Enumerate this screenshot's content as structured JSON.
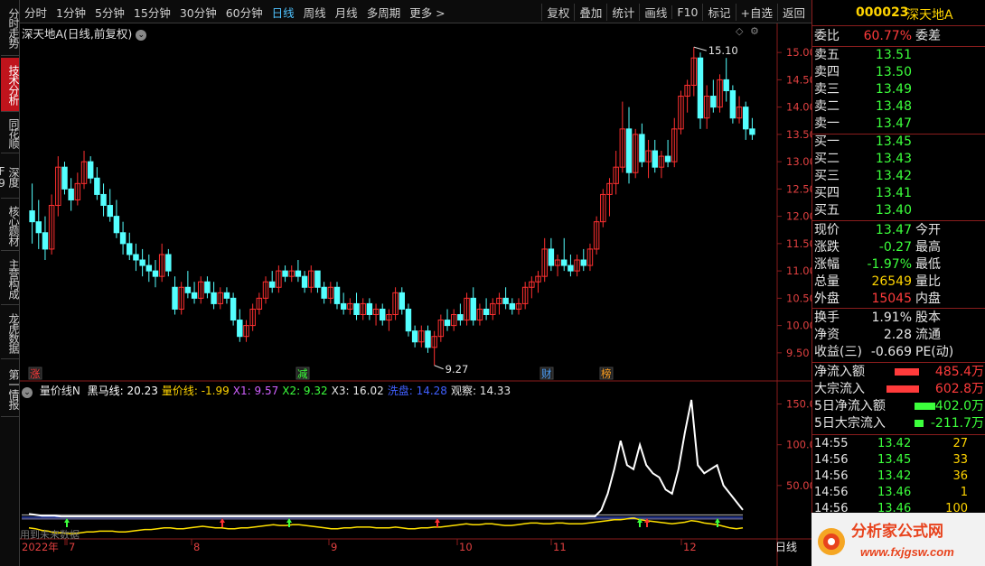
{
  "toolbar": {
    "periods": [
      "分时",
      "1分钟",
      "5分钟",
      "15分钟",
      "30分钟",
      "60分钟",
      "日线",
      "周线",
      "月线",
      "多周期",
      "更多 >"
    ],
    "active_period": "日线",
    "tools": [
      "复权",
      "叠加",
      "统计",
      "画线",
      "F10",
      "标记",
      "+自选",
      "返回"
    ]
  },
  "left_tabs": [
    {
      "label": "分时走势",
      "active": false
    },
    {
      "label": "技术分析",
      "active": true
    },
    {
      "label": "同花顺",
      "active": false
    },
    {
      "label": "深度F9",
      "active": false
    },
    {
      "label": "核心题材",
      "active": false
    },
    {
      "label": "主营构成",
      "active": false
    },
    {
      "label": "龙虎数据",
      "active": false
    },
    {
      "label": "第一情报",
      "active": false
    }
  ],
  "main_chart": {
    "title": "深天地A(日线,前复权)",
    "high_marker": "15.10",
    "low_marker": "9.27",
    "event_marks": [
      {
        "text": "涨",
        "color": "#ff3b3b"
      },
      {
        "text": "减",
        "color": "#3cff3c"
      },
      {
        "text": "财",
        "color": "#4fa3ff"
      },
      {
        "text": "榜",
        "color": "#ffa020"
      }
    ]
  },
  "indicator": {
    "name": "量价线N",
    "items": [
      {
        "label": "黑马线: 20.23",
        "color": "#ffffff"
      },
      {
        "label": "量价线: -1.99",
        "color": "#ffd400"
      },
      {
        "label": "X1: 9.57",
        "color": "#d060ff"
      },
      {
        "label": "X2: 9.32",
        "color": "#3cff3c"
      },
      {
        "label": "X3: 16.02",
        "color": "#e6e6e6"
      },
      {
        "label": "洗盘: 14.28",
        "color": "#4060ff"
      },
      {
        "label": "观察: 14.33",
        "color": "#e6e6e6"
      }
    ],
    "footer_note": "用到未来数据"
  },
  "x_axis": {
    "labels": [
      "2022年",
      "7",
      "8",
      "9",
      "10",
      "11",
      "12"
    ],
    "period_button": "日线"
  },
  "chart_data": {
    "type": "candlestick",
    "price_axis": {
      "ticks": [
        15.0,
        14.5,
        14.0,
        13.5,
        13.0,
        12.5,
        12.0,
        11.5,
        11.0,
        10.5,
        10.0,
        9.5
      ],
      "ylim": [
        9.2,
        15.3
      ]
    },
    "indicator_axis": {
      "ticks": [
        150.0,
        100.0,
        50.0
      ],
      "ylim": [
        -10,
        165
      ]
    },
    "candles": [
      [
        12.1,
        12.6,
        11.5,
        11.9
      ],
      [
        11.9,
        12.3,
        11.4,
        11.7
      ],
      [
        11.7,
        12.0,
        11.2,
        11.4
      ],
      [
        11.4,
        12.4,
        11.3,
        12.2
      ],
      [
        12.2,
        13.1,
        12.0,
        12.9
      ],
      [
        12.9,
        13.0,
        12.4,
        12.5
      ],
      [
        12.5,
        12.7,
        12.1,
        12.3
      ],
      [
        12.3,
        12.8,
        12.2,
        12.6
      ],
      [
        12.6,
        13.2,
        12.5,
        13.0
      ],
      [
        13.0,
        13.1,
        12.6,
        12.7
      ],
      [
        12.7,
        12.9,
        12.3,
        12.4
      ],
      [
        12.4,
        12.6,
        12.0,
        12.2
      ],
      [
        12.2,
        12.5,
        11.9,
        12.0
      ],
      [
        12.0,
        12.3,
        11.6,
        11.7
      ],
      [
        11.7,
        11.9,
        11.3,
        11.5
      ],
      [
        11.5,
        11.7,
        11.2,
        11.3
      ],
      [
        11.3,
        11.5,
        11.0,
        11.2
      ],
      [
        11.2,
        11.4,
        10.9,
        11.1
      ],
      [
        11.1,
        11.3,
        10.8,
        11.0
      ],
      [
        11.0,
        11.2,
        10.7,
        10.9
      ],
      [
        10.9,
        11.5,
        10.8,
        11.3
      ],
      [
        11.3,
        11.4,
        10.9,
        11.0
      ],
      [
        10.7,
        10.9,
        10.2,
        10.3
      ],
      [
        10.3,
        10.8,
        10.2,
        10.7
      ],
      [
        10.7,
        11.0,
        10.5,
        10.6
      ],
      [
        10.6,
        10.8,
        10.4,
        10.5
      ],
      [
        10.5,
        10.9,
        10.4,
        10.8
      ],
      [
        10.8,
        10.9,
        10.5,
        10.6
      ],
      [
        10.6,
        10.8,
        10.3,
        10.4
      ],
      [
        10.4,
        10.7,
        10.3,
        10.6
      ],
      [
        10.6,
        10.7,
        10.4,
        10.5
      ],
      [
        10.5,
        10.6,
        10.0,
        10.1
      ],
      [
        10.1,
        10.3,
        9.7,
        9.8
      ],
      [
        9.8,
        10.1,
        9.7,
        10.0
      ],
      [
        10.0,
        10.4,
        9.9,
        10.3
      ],
      [
        10.3,
        10.6,
        10.2,
        10.5
      ],
      [
        10.5,
        10.9,
        10.4,
        10.8
      ],
      [
        10.8,
        11.0,
        10.6,
        10.7
      ],
      [
        10.7,
        11.1,
        10.6,
        11.0
      ],
      [
        11.0,
        11.1,
        10.8,
        10.9
      ],
      [
        10.9,
        11.1,
        10.8,
        11.0
      ],
      [
        11.0,
        11.2,
        10.8,
        10.9
      ],
      [
        10.9,
        11.0,
        10.6,
        10.7
      ],
      [
        10.7,
        11.1,
        10.6,
        11.0
      ],
      [
        11.0,
        11.0,
        10.6,
        10.7
      ],
      [
        10.7,
        10.8,
        10.4,
        10.5
      ],
      [
        10.5,
        10.8,
        10.4,
        10.7
      ],
      [
        10.7,
        10.8,
        10.3,
        10.4
      ],
      [
        10.4,
        10.6,
        10.2,
        10.3
      ],
      [
        10.3,
        10.5,
        10.2,
        10.4
      ],
      [
        10.4,
        10.6,
        10.1,
        10.2
      ],
      [
        10.2,
        10.5,
        10.1,
        10.4
      ],
      [
        10.4,
        10.5,
        10.1,
        10.2
      ],
      [
        10.2,
        10.4,
        10.0,
        10.3
      ],
      [
        10.3,
        10.4,
        10.0,
        10.1
      ],
      [
        10.1,
        10.3,
        9.9,
        10.2
      ],
      [
        10.2,
        10.7,
        10.1,
        10.6
      ],
      [
        10.6,
        10.7,
        10.2,
        10.3
      ],
      [
        10.3,
        10.4,
        9.8,
        9.9
      ],
      [
        9.9,
        10.0,
        9.6,
        9.7
      ],
      [
        9.7,
        10.0,
        9.6,
        9.9
      ],
      [
        9.9,
        10.0,
        9.5,
        9.6
      ],
      [
        9.6,
        9.9,
        9.27,
        9.8
      ],
      [
        9.8,
        10.2,
        9.7,
        10.1
      ],
      [
        10.1,
        10.3,
        9.9,
        10.0
      ],
      [
        10.0,
        10.3,
        9.9,
        10.2
      ],
      [
        10.2,
        10.4,
        10.0,
        10.1
      ],
      [
        10.1,
        10.6,
        10.0,
        10.5
      ],
      [
        10.5,
        10.7,
        10.0,
        10.1
      ],
      [
        10.1,
        10.4,
        10.0,
        10.3
      ],
      [
        10.3,
        10.5,
        10.1,
        10.2
      ],
      [
        10.2,
        10.5,
        10.1,
        10.4
      ],
      [
        10.4,
        10.6,
        10.2,
        10.5
      ],
      [
        10.5,
        10.7,
        10.3,
        10.4
      ],
      [
        10.4,
        10.5,
        10.2,
        10.3
      ],
      [
        10.3,
        10.5,
        10.2,
        10.4
      ],
      [
        10.4,
        10.8,
        10.3,
        10.7
      ],
      [
        10.7,
        10.9,
        10.5,
        10.8
      ],
      [
        10.8,
        11.0,
        10.6,
        10.9
      ],
      [
        10.9,
        11.6,
        10.8,
        11.4
      ],
      [
        11.4,
        11.6,
        11.0,
        11.1
      ],
      [
        11.1,
        11.3,
        10.9,
        11.2
      ],
      [
        11.2,
        11.6,
        11.0,
        11.1
      ],
      [
        11.1,
        11.3,
        10.9,
        11.0
      ],
      [
        11.0,
        11.3,
        10.9,
        11.2
      ],
      [
        11.2,
        11.4,
        11.0,
        11.1
      ],
      [
        11.1,
        11.5,
        11.0,
        11.4
      ],
      [
        11.4,
        12.0,
        11.3,
        11.9
      ],
      [
        11.9,
        12.5,
        11.8,
        12.4
      ],
      [
        12.4,
        12.7,
        12.0,
        12.6
      ],
      [
        12.6,
        13.2,
        12.4,
        12.9
      ],
      [
        12.9,
        14.1,
        12.8,
        13.6
      ],
      [
        13.6,
        14.0,
        12.6,
        12.8
      ],
      [
        12.8,
        13.6,
        12.7,
        13.5
      ],
      [
        13.5,
        13.7,
        12.9,
        13.0
      ],
      [
        13.0,
        13.4,
        12.7,
        13.2
      ],
      [
        13.2,
        13.4,
        12.8,
        12.9
      ],
      [
        12.9,
        13.2,
        12.7,
        13.1
      ],
      [
        13.1,
        13.4,
        12.9,
        13.0
      ],
      [
        13.0,
        13.8,
        12.9,
        13.6
      ],
      [
        13.6,
        14.3,
        13.5,
        14.2
      ],
      [
        14.2,
        14.5,
        13.9,
        14.4
      ],
      [
        14.4,
        15.1,
        14.2,
        14.9
      ],
      [
        14.9,
        15.0,
        13.6,
        13.8
      ],
      [
        13.8,
        14.4,
        13.6,
        14.2
      ],
      [
        14.2,
        14.5,
        13.9,
        14.0
      ],
      [
        14.0,
        14.6,
        13.9,
        14.5
      ],
      [
        14.5,
        14.9,
        14.1,
        14.3
      ],
      [
        14.3,
        14.4,
        13.7,
        13.8
      ],
      [
        13.8,
        14.2,
        13.7,
        14.0
      ],
      [
        14.0,
        14.1,
        13.4,
        13.6
      ],
      [
        13.6,
        13.8,
        13.4,
        13.5
      ]
    ],
    "indicator_white": [
      15,
      14,
      13,
      13,
      13,
      12,
      12,
      12,
      12,
      12,
      12,
      12,
      12,
      12,
      12,
      12,
      12,
      12,
      12,
      12,
      12,
      12,
      12,
      12,
      12,
      12,
      12,
      12,
      12,
      12,
      12,
      12,
      12,
      12,
      12,
      12,
      12,
      12,
      12,
      12,
      12,
      12,
      12,
      12,
      12,
      12,
      12,
      12,
      12,
      12,
      12,
      12,
      12,
      12,
      12,
      12,
      12,
      12,
      12,
      12,
      12,
      12,
      12,
      12,
      12,
      12,
      12,
      12,
      12,
      12,
      12,
      12,
      12,
      12,
      12,
      12,
      12,
      12,
      12,
      12,
      12,
      12,
      12,
      12,
      12,
      12,
      12,
      12,
      12,
      20,
      40,
      70,
      105,
      75,
      70,
      100,
      75,
      65,
      60,
      45,
      40,
      70,
      115,
      155,
      75,
      65,
      70,
      75,
      50,
      40,
      30,
      20
    ],
    "indicator_yellow": [
      -2,
      -3,
      -5,
      -6,
      -8,
      -8,
      -9,
      -9,
      -8,
      -7,
      -7,
      -6,
      -6,
      -6,
      -7,
      -7,
      -6,
      -5,
      -4,
      -4,
      -3,
      -2,
      -2,
      -3,
      -3,
      -2,
      -1,
      0,
      -1,
      -2,
      -2,
      -3,
      -3,
      -2,
      -2,
      -1,
      0,
      1,
      2,
      1,
      1,
      2,
      2,
      1,
      0,
      -1,
      -2,
      -3,
      -3,
      -2,
      -2,
      -1,
      -1,
      -1,
      -2,
      -2,
      -2,
      -1,
      -2,
      -3,
      -3,
      -2,
      -2,
      -1,
      -1,
      0,
      1,
      2,
      3,
      2,
      2,
      3,
      3,
      2,
      1,
      1,
      2,
      3,
      4,
      4,
      3,
      3,
      4,
      4,
      3,
      3,
      3,
      4,
      5,
      6,
      7,
      8,
      8,
      9,
      10,
      8,
      7,
      6,
      5,
      4,
      3,
      4,
      5,
      7,
      6,
      4,
      3,
      2,
      0,
      -2,
      -3,
      -2
    ]
  },
  "quote": {
    "code": "000023",
    "name": "深天地A",
    "weibi": {
      "label": "委比",
      "value": "60.77%",
      "label2": "委差"
    },
    "asks": [
      {
        "label": "卖五",
        "price": "13.51"
      },
      {
        "label": "卖四",
        "price": "13.50"
      },
      {
        "label": "卖三",
        "price": "13.49"
      },
      {
        "label": "卖二",
        "price": "13.48"
      },
      {
        "label": "卖一",
        "price": "13.47"
      }
    ],
    "bids": [
      {
        "label": "买一",
        "price": "13.45"
      },
      {
        "label": "买二",
        "price": "13.43"
      },
      {
        "label": "买三",
        "price": "13.42"
      },
      {
        "label": "买四",
        "price": "13.41"
      },
      {
        "label": "买五",
        "price": "13.40"
      }
    ],
    "stats": [
      {
        "label": "现价",
        "value": "13.47",
        "color": "green",
        "label2": "今开"
      },
      {
        "label": "涨跌",
        "value": "-0.27",
        "color": "green",
        "label2": "最高"
      },
      {
        "label": "涨幅",
        "value": "-1.97%",
        "color": "green",
        "label2": "最低"
      },
      {
        "label": "总量",
        "value": "26549",
        "color": "yel",
        "label2": "量比"
      },
      {
        "label": "外盘",
        "value": "15045",
        "color": "red",
        "label2": "内盘"
      }
    ],
    "stats2": [
      {
        "label": "换手",
        "value": "1.91%",
        "label2": "股本"
      },
      {
        "label": "净资",
        "value": "2.28",
        "label2": "流通"
      },
      {
        "label": "收益(三)",
        "value": "-0.669",
        "label2": "PE(动)"
      }
    ],
    "flows": [
      {
        "label": "净流入额",
        "value": "485.4万",
        "color": "red",
        "fraction": 0.55
      },
      {
        "label": "大宗流入",
        "value": "602.8万",
        "color": "red",
        "fraction": 0.72
      },
      {
        "label": "5日净流入额",
        "value": "-402.0万",
        "color": "green",
        "fraction": 0.45
      },
      {
        "label": "5日大宗流入",
        "value": "-211.7万",
        "color": "green",
        "fraction": 0.2
      }
    ],
    "ticks": [
      {
        "time": "14:55",
        "price": "13.42",
        "vol": "27"
      },
      {
        "time": "14:56",
        "price": "13.45",
        "vol": "33"
      },
      {
        "time": "14:56",
        "price": "13.42",
        "vol": "36"
      },
      {
        "time": "14:56",
        "price": "13.46",
        "vol": "1"
      },
      {
        "time": "14:56",
        "price": "13.46",
        "vol": "100"
      }
    ]
  },
  "watermark": {
    "text": "分析家公式网",
    "url": "www.fxjgsw.com"
  }
}
